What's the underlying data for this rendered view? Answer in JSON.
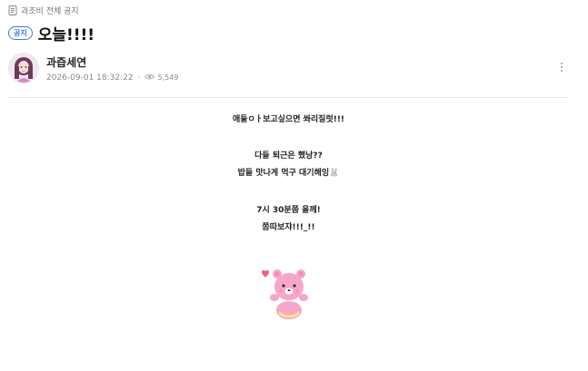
{
  "board": {
    "name": "과조비 전체 공지"
  },
  "post": {
    "badge": "공지",
    "title": "오늘!!!!"
  },
  "author": {
    "name": "과즙세연",
    "date": "2026-09-01 18:32:22",
    "separator": "·",
    "views": "5,549"
  },
  "content": {
    "lines": [
      "애둘ㅇㅏ보고싶으면 쏴리질럿!!!",
      "다들 퇴근은 했낭??",
      "밥들 맛나게 먹구 대기해잉🐰",
      "7시 30분쯤 올께!",
      "쫌따보쟈!!!_!!"
    ]
  },
  "icons": {
    "board": "document-icon",
    "views": "eye-icon",
    "more": "more-vertical-icon",
    "sticker": "pink-bear-sticker"
  },
  "colors": {
    "accent": "#3a78e8",
    "meta": "#8a8a8a",
    "sticker_pink": "#f6a7c9"
  }
}
